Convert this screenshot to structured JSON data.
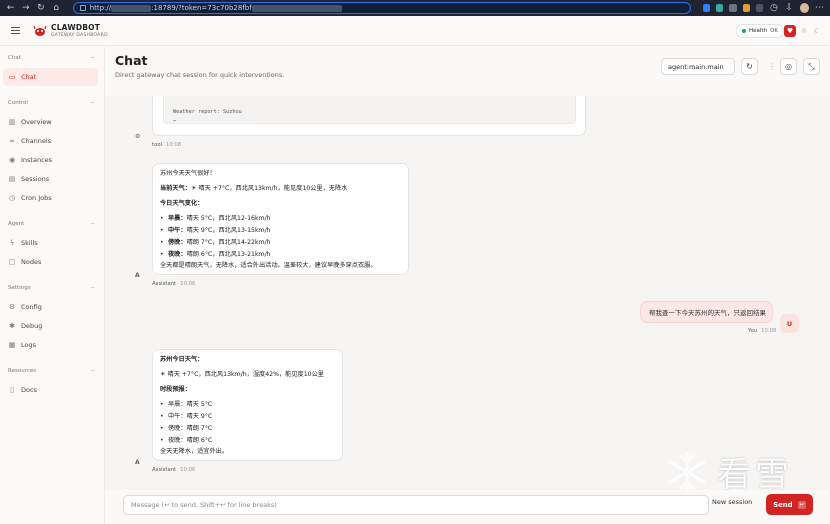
{
  "browser": {
    "url_prefix": "http://",
    "url_middle": ":18789/?token=73c70b28fbf",
    "health_label": "Health",
    "health_status": "OK"
  },
  "brand": {
    "name": "CLAWDBOT",
    "subtitle": "GATEWAY DASHBOARD"
  },
  "sidebar": {
    "sections": [
      {
        "title": "Chat",
        "items": [
          {
            "label": "Chat",
            "icon": "chat-icon",
            "active": true
          }
        ]
      },
      {
        "title": "Control",
        "items": [
          {
            "label": "Overview",
            "icon": "bar-chart-icon"
          },
          {
            "label": "Channels",
            "icon": "link-icon"
          },
          {
            "label": "Instances",
            "icon": "radio-icon"
          },
          {
            "label": "Sessions",
            "icon": "file-icon"
          },
          {
            "label": "Cron Jobs",
            "icon": "clock-icon"
          }
        ]
      },
      {
        "title": "Agent",
        "items": [
          {
            "label": "Skills",
            "icon": "zap-icon"
          },
          {
            "label": "Nodes",
            "icon": "monitor-icon"
          }
        ]
      },
      {
        "title": "Settings",
        "items": [
          {
            "label": "Config",
            "icon": "gear-icon"
          },
          {
            "label": "Debug",
            "icon": "bug-icon"
          },
          {
            "label": "Logs",
            "icon": "document-icon"
          }
        ]
      },
      {
        "title": "Resources",
        "items": [
          {
            "label": "Docs",
            "icon": "book-icon"
          }
        ]
      }
    ]
  },
  "main": {
    "title": "Chat",
    "subtitle": "Direct gateway chat session for quick interventions.",
    "agent_select": "agent:main:main"
  },
  "messages": {
    "tool_card_line1": "Weather report: Suzhou",
    "tool_card_line2": "…",
    "tool_meta": {
      "sender": "tool",
      "time": "10:08"
    },
    "assistant1": {
      "line_intro": "苏州今天天气很好！",
      "current_label": "当前天气：",
      "current_text": "☀ 晴天 +7°C，西北风13km/h，能见度10公里，无降水",
      "change_label": "今日天气变化：",
      "periods": [
        {
          "label": "早晨：",
          "text": "晴天 5°C，西北风12-16km/h"
        },
        {
          "label": "中午：",
          "text": "晴天 9°C，西北风13-15km/h"
        },
        {
          "label": "傍晚：",
          "text": "晴朗 7°C，西北风14-22km/h"
        },
        {
          "label": "夜晚：",
          "text": "晴朗 6°C，西北风13-21km/h"
        }
      ],
      "summary": "全天都是晴朗天气，无降水，适合外出活动。温差较大，建议早晚多穿点衣服。"
    },
    "assistant1_meta": {
      "sender": "Assistant",
      "time": "10:06"
    },
    "user1": "帮我查一下今天苏州的天气，只返回结果",
    "user1_meta": {
      "sender": "You",
      "time": "10:08"
    },
    "user_avatar": "U",
    "assistant2": {
      "title": "苏州今日天气：",
      "current": "☀ 晴天 +7°C，西北风13km/h，湿度42%，能见度10公里",
      "forecast_label": "时段预报：",
      "periods": [
        {
          "text": "早晨：晴天 5°C"
        },
        {
          "text": "中午：晴天 9°C"
        },
        {
          "text": "傍晚：晴朗 7°C"
        },
        {
          "text": "夜晚：晴朗 6°C"
        }
      ],
      "summary": "全天无降水，适宜外出。"
    },
    "assistant2_meta": {
      "sender": "Assistant",
      "time": "10:06"
    },
    "assistant_avatar": "A",
    "tool_avatar": "⚙"
  },
  "composer": {
    "placeholder": "Message (↩ to send, Shift+↩ for line breaks)",
    "new_session": "New session",
    "send": "Send",
    "send_kbd": "↩"
  },
  "watermark": "看雪",
  "colors": {
    "accent": "#d32424",
    "active_bg": "#fde9e6",
    "health_ok": "#22a55a"
  }
}
